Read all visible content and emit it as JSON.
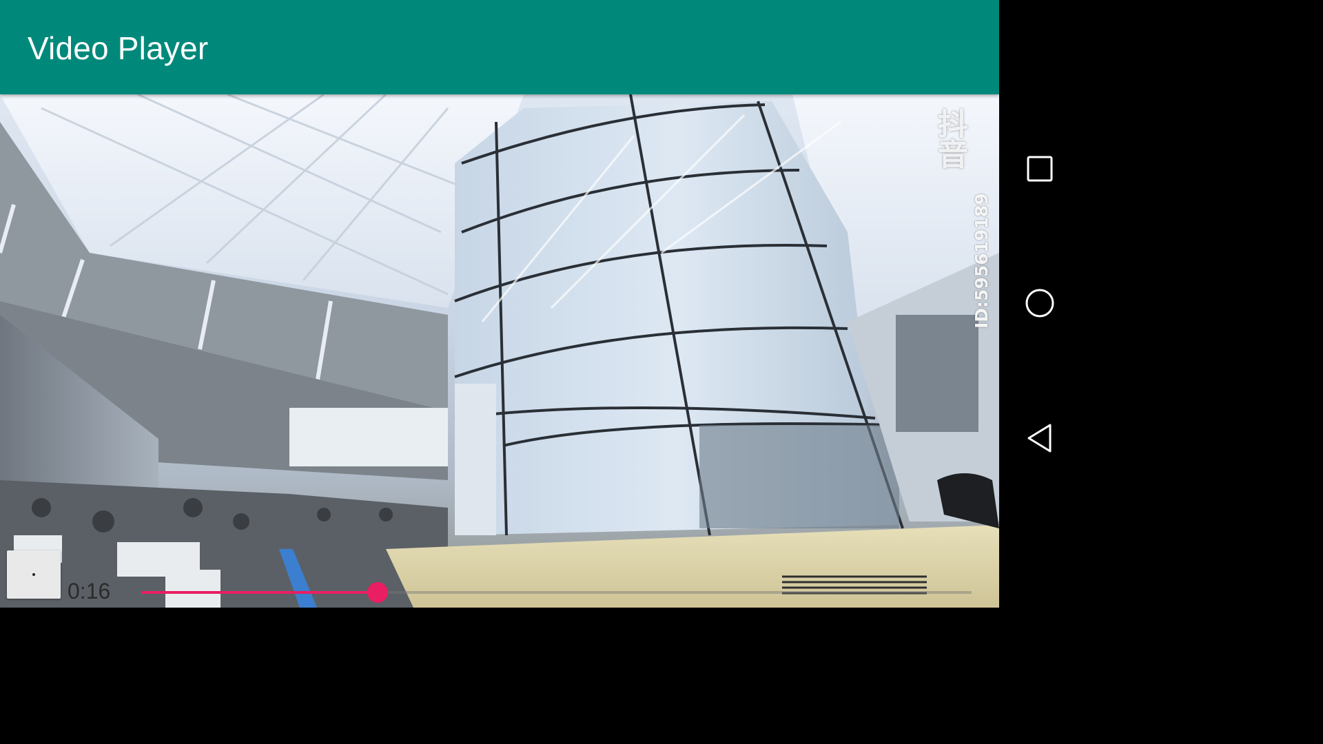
{
  "app_bar": {
    "title": "Video Player",
    "color": "#00897b"
  },
  "video": {
    "watermark_logo": "抖音",
    "watermark_id": "ID:595619189"
  },
  "controls": {
    "play_button_icon": "pause-dot-icon",
    "current_time": "0:16",
    "progress": 0.285,
    "accent_color": "#e91e63"
  },
  "navigation_bar": {
    "recents_icon": "square-icon",
    "home_icon": "circle-icon",
    "back_icon": "triangle-back-icon"
  }
}
